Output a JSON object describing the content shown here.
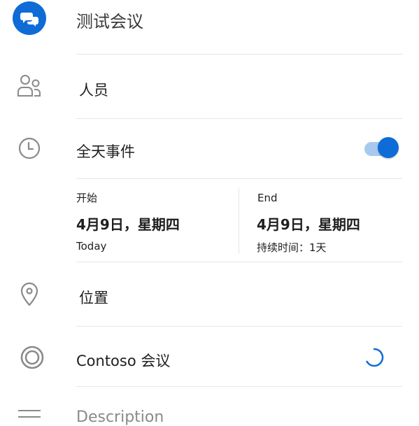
{
  "title": {
    "value": "测试会议"
  },
  "people": {
    "label": "人员"
  },
  "all_day": {
    "label": "全天事件",
    "enabled": true
  },
  "start": {
    "header": "开始",
    "date": "4月9日，星期四",
    "sub": "Today"
  },
  "end": {
    "header": "End",
    "date": "4月9日，星期四",
    "duration": "持续时间：1天"
  },
  "location": {
    "label": "位置"
  },
  "meeting": {
    "label": "Contoso 会议"
  },
  "description": {
    "placeholder": "Description"
  },
  "colors": {
    "accent": "#0f6cd6",
    "accent_light": "#a8c9ee",
    "icon_gray": "#8a8a8a",
    "divider": "#e6e6e6"
  },
  "icons": [
    "chat-bubbles-icon",
    "people-icon",
    "clock-icon",
    "location-pin-icon",
    "contoso-rings-icon",
    "loading-spinner-icon",
    "menu-lines-icon"
  ]
}
